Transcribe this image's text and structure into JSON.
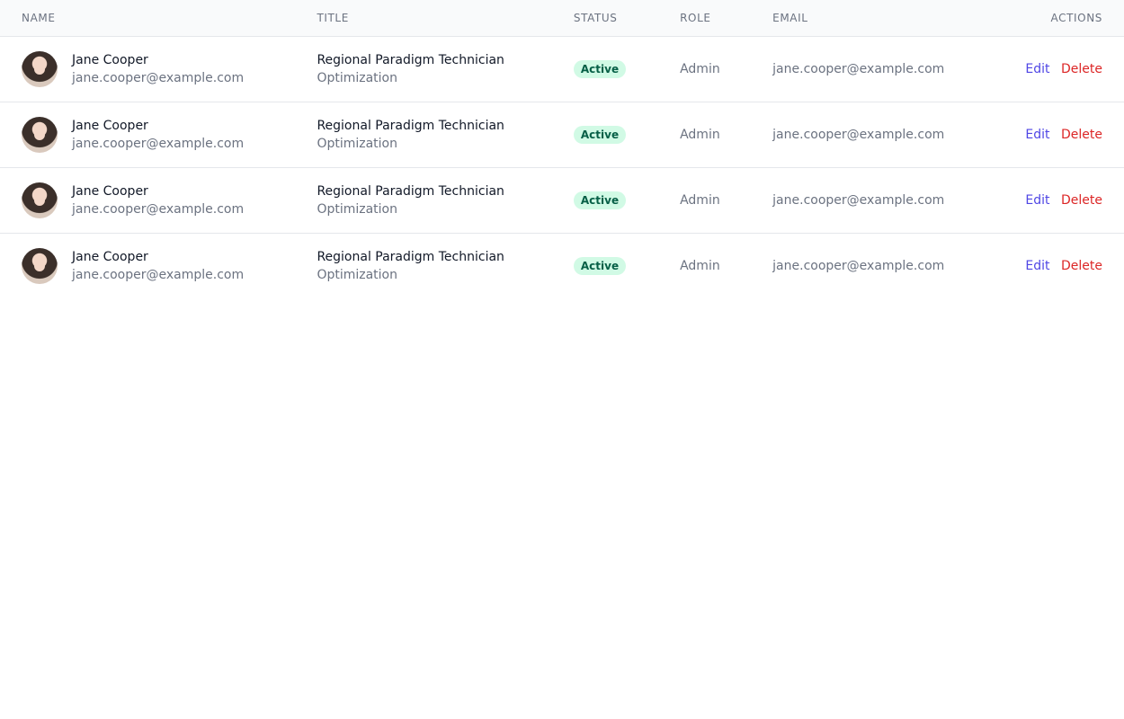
{
  "table": {
    "headers": {
      "name": "Name",
      "title": "Title",
      "status": "Status",
      "role": "Role",
      "email": "Email",
      "actions": "Actions"
    },
    "rows": [
      {
        "name": "Jane Cooper",
        "name_sub": "jane.cooper@example.com",
        "title": "Regional Paradigm Technician",
        "title_sub": "Optimization",
        "status": "Active",
        "role": "Admin",
        "email": "jane.cooper@example.com",
        "edit": "Edit",
        "delete": "Delete"
      },
      {
        "name": "Jane Cooper",
        "name_sub": "jane.cooper@example.com",
        "title": "Regional Paradigm Technician",
        "title_sub": "Optimization",
        "status": "Active",
        "role": "Admin",
        "email": "jane.cooper@example.com",
        "edit": "Edit",
        "delete": "Delete"
      },
      {
        "name": "Jane Cooper",
        "name_sub": "jane.cooper@example.com",
        "title": "Regional Paradigm Technician",
        "title_sub": "Optimization",
        "status": "Active",
        "role": "Admin",
        "email": "jane.cooper@example.com",
        "edit": "Edit",
        "delete": "Delete"
      },
      {
        "name": "Jane Cooper",
        "name_sub": "jane.cooper@example.com",
        "title": "Regional Paradigm Technician",
        "title_sub": "Optimization",
        "status": "Active",
        "role": "Admin",
        "email": "jane.cooper@example.com",
        "edit": "Edit",
        "delete": "Delete"
      }
    ]
  }
}
